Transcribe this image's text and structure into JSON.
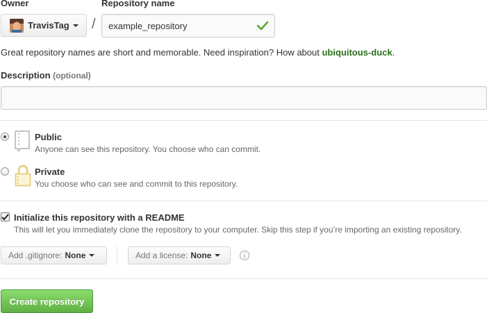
{
  "owner": {
    "label": "Owner",
    "selected": "TravisTag"
  },
  "repo_name": {
    "label": "Repository name",
    "separator": "/",
    "value": "example_repository",
    "valid": true
  },
  "suggestion": {
    "text": "Great repository names are short and memorable. Need inspiration? How about ",
    "name": "ubiquitous-duck",
    "end": "."
  },
  "description": {
    "label": "Description",
    "optional": "(optional)",
    "value": ""
  },
  "visibility": {
    "selected": "public",
    "options": [
      {
        "id": "public",
        "title": "Public",
        "desc": "Anyone can see this repository. You choose who can commit."
      },
      {
        "id": "private",
        "title": "Private",
        "desc": "You choose who can see and commit to this repository."
      }
    ]
  },
  "init_readme": {
    "checked": true,
    "title": "Initialize this repository with a README",
    "desc": "This will let you immediately clone the repository to your computer. Skip this step if you’re importing an existing repository."
  },
  "gitignore": {
    "label": "Add .gitignore:",
    "value": "None"
  },
  "license": {
    "label": "Add a license:",
    "value": "None"
  },
  "submit": {
    "label": "Create repository"
  },
  "colors": {
    "suggestion_link": "#2c6e1a",
    "valid_check": "#55a532",
    "create_button": "#60b044"
  }
}
